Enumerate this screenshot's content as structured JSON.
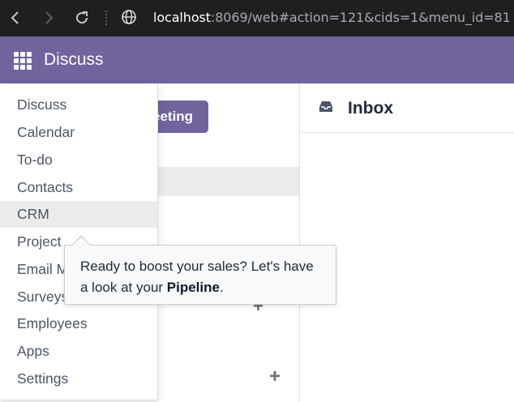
{
  "browser": {
    "url_host": "localhost",
    "url_rest": ":8069/web#action=121&cids=1&menu_id=81"
  },
  "header": {
    "app_title": "Discuss"
  },
  "sidebar": {
    "start_meeting_label": "Start a meeting",
    "start_meeting_visible_fragment": "eeting"
  },
  "thread": {
    "title": "Inbox"
  },
  "apps_menu": {
    "items": [
      {
        "label": "Discuss"
      },
      {
        "label": "Calendar"
      },
      {
        "label": "To-do"
      },
      {
        "label": "Contacts"
      },
      {
        "label": "CRM"
      },
      {
        "label": "Project"
      },
      {
        "label": "Email M"
      },
      {
        "label": "Surveys"
      },
      {
        "label": "Employees"
      },
      {
        "label": "Apps"
      },
      {
        "label": "Settings"
      }
    ]
  },
  "tooltip": {
    "text_before": "Ready to boost your sales? Let's have a look at your ",
    "text_bold": "Pipeline",
    "text_after": "."
  },
  "colors": {
    "brand": "#71639e",
    "browser_bar": "#1f1f22",
    "active_row": "#ebebeb"
  },
  "icons": {
    "back": "chevron-left-icon",
    "forward": "chevron-right-icon",
    "reload": "reload-icon",
    "site": "globe-icon",
    "apps": "grid-icon",
    "inbox": "inbox-icon",
    "add": "plus-icon"
  }
}
